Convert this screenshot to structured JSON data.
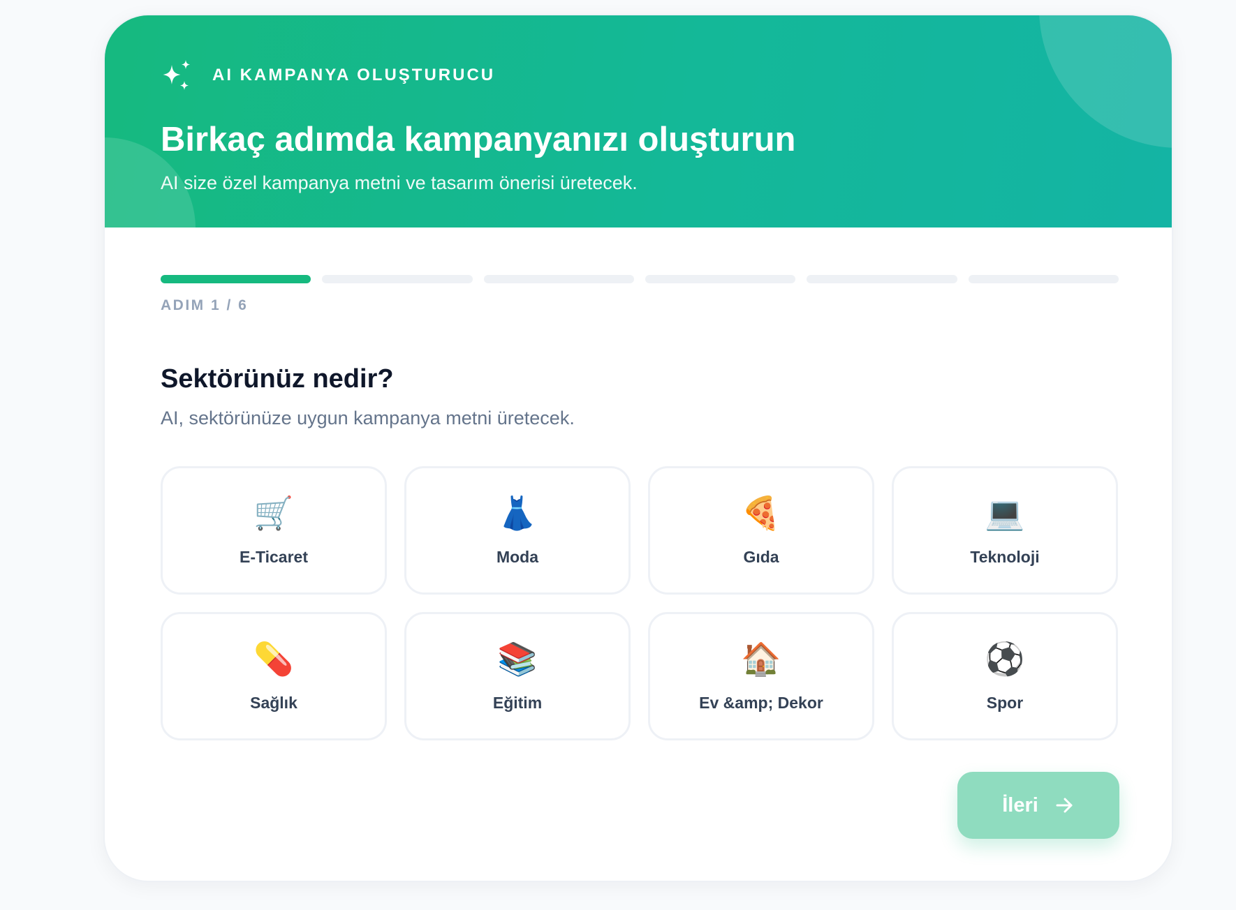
{
  "header": {
    "eyebrow": "AI KAMPANYA OLUŞTURUCU",
    "title": "Birkaç adımda kampanyanızı oluşturun",
    "subtitle": "AI size özel kampanya metni ve tasarım önerisi üretecek.",
    "eyebrow_icon": "sparkles-icon"
  },
  "progress": {
    "current_step": 1,
    "total_steps": 6,
    "label": "ADIM 1 / 6"
  },
  "question": {
    "title": "Sektörünüz nedir?",
    "subtitle": "AI, sektörünüze uygun kampanya metni üretecek."
  },
  "options": [
    {
      "icon": "🛒",
      "label": "E-Ticaret",
      "icon_name": "shopping-cart-icon"
    },
    {
      "icon": "👗",
      "label": "Moda",
      "icon_name": "dress-icon"
    },
    {
      "icon": "🍕",
      "label": "Gıda",
      "icon_name": "pizza-icon"
    },
    {
      "icon": "💻",
      "label": "Teknoloji",
      "icon_name": "laptop-icon"
    },
    {
      "icon": "💊",
      "label": "Sağlık",
      "icon_name": "pill-icon"
    },
    {
      "icon": "📚",
      "label": "Eğitim",
      "icon_name": "books-icon"
    },
    {
      "icon": "🏠",
      "label": "Ev &amp; Dekor",
      "icon_name": "house-icon"
    },
    {
      "icon": "⚽",
      "label": "Spor",
      "icon_name": "soccer-ball-icon"
    }
  ],
  "actions": {
    "next_label": "İleri",
    "next_icon": "arrow-right-icon",
    "next_enabled": false
  },
  "colors": {
    "brand": "#16b97f",
    "brand_teal": "#14b4a4",
    "next_disabled": "#8fdcbf",
    "progress_inactive": "#eef1f5"
  }
}
